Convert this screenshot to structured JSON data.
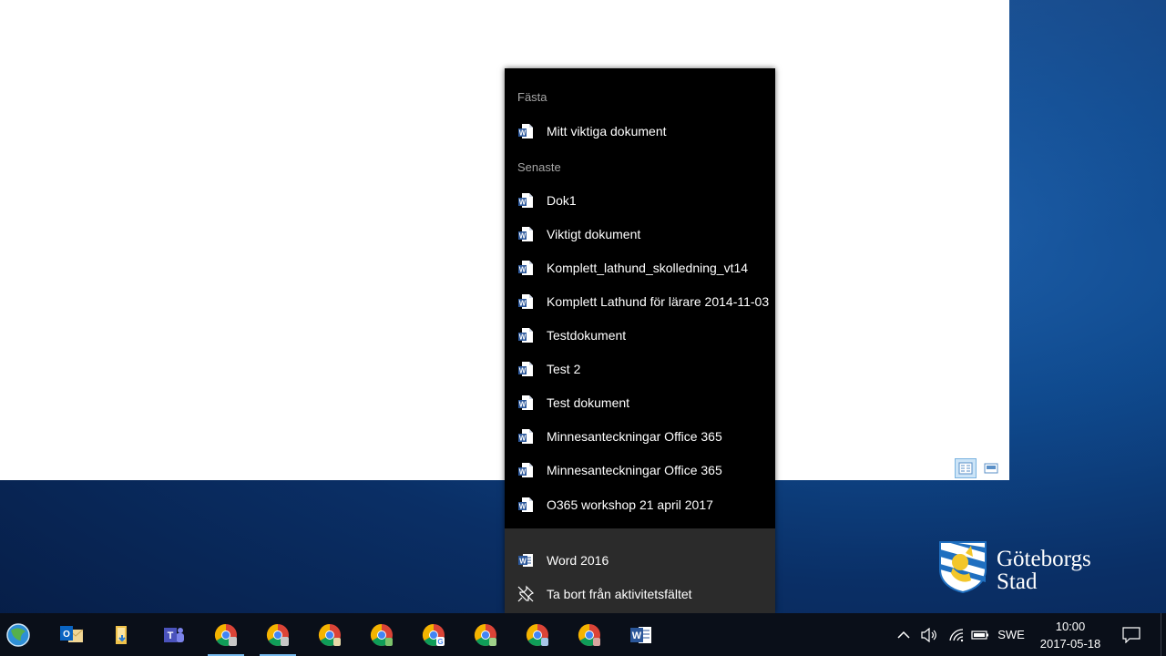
{
  "jumplist": {
    "pinned_heading": "Fästa",
    "pinned": [
      {
        "label": "Mitt viktiga dokument"
      }
    ],
    "recent_heading": "Senaste",
    "recent": [
      {
        "label": "Dok1"
      },
      {
        "label": "Viktigt dokument"
      },
      {
        "label": "Komplett_lathund_skolledning_vt14"
      },
      {
        "label": "Komplett Lathund för lärare 2014-11-03"
      },
      {
        "label": "Testdokument"
      },
      {
        "label": "Test 2"
      },
      {
        "label": "Test dokument"
      },
      {
        "label": "Minnesanteckningar Office 365"
      },
      {
        "label": "Minnesanteckningar Office 365"
      },
      {
        "label": "O365 workshop 21 april 2017"
      }
    ],
    "app_label": "Word 2016",
    "unpin_label": "Ta bort från aktivitetsfältet"
  },
  "logo": {
    "line1": "Göteborgs",
    "line2": "Stad"
  },
  "taskbar": {
    "apps": [
      {
        "icon": "globe-icon"
      },
      {
        "icon": "outlook-icon"
      },
      {
        "icon": "file-explorer-icon"
      },
      {
        "icon": "teams-icon"
      },
      {
        "icon": "chrome-icon",
        "active": true
      },
      {
        "icon": "chrome-icon",
        "active": true
      },
      {
        "icon": "chrome-icon"
      },
      {
        "icon": "chrome-icon"
      },
      {
        "icon": "chrome-icon"
      },
      {
        "icon": "chrome-icon"
      },
      {
        "icon": "chrome-icon"
      },
      {
        "icon": "chrome-icon"
      },
      {
        "icon": "word-icon"
      }
    ],
    "language": "SWE",
    "time": "10:00",
    "date": "2017-05-18"
  },
  "colors": {
    "jumplist_bg": "#000000",
    "jumplist_footer_bg": "#2b2b2b",
    "word_blue": "#2b579a",
    "taskbar_bg": "#0a0f19"
  }
}
